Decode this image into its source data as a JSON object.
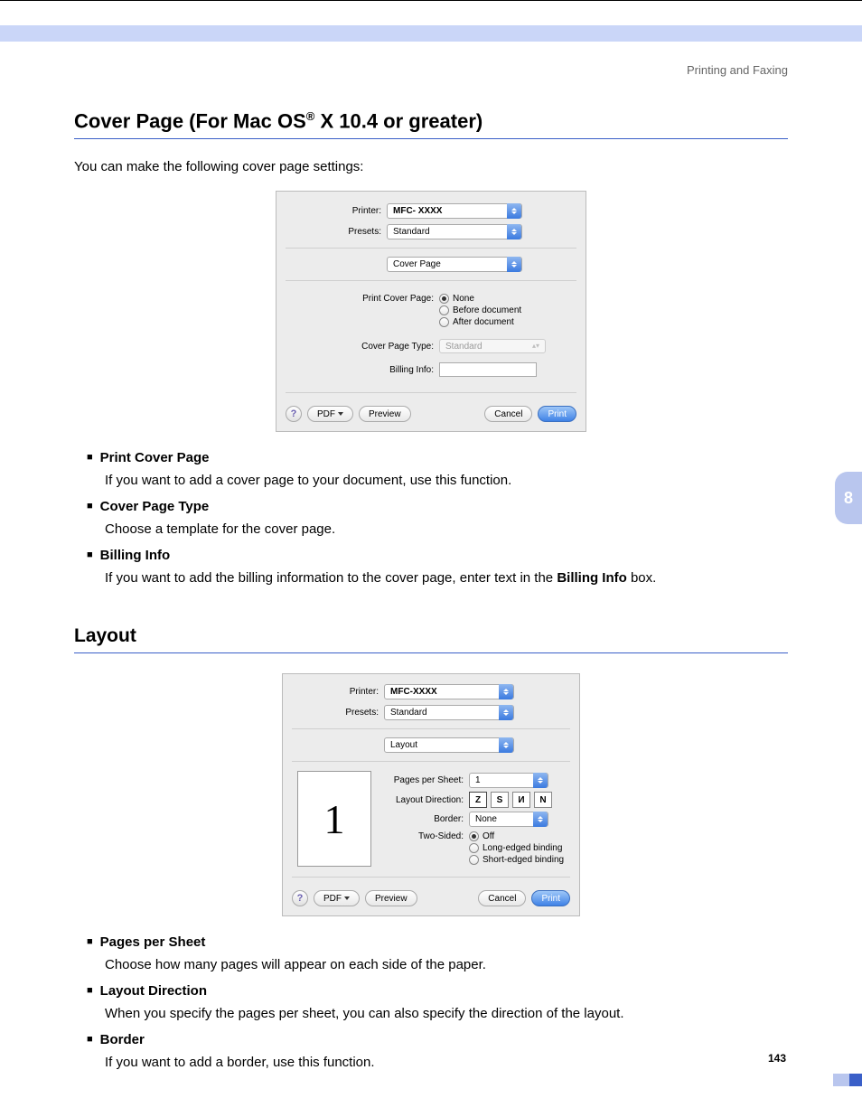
{
  "header": {
    "section": "Printing and Faxing"
  },
  "h1": {
    "pre": "Cover Page (For Mac OS",
    "sup": "®",
    "post": " X 10.4 or greater)"
  },
  "intro1": "You can make the following cover page settings:",
  "dialog1": {
    "labels": {
      "printer": "Printer:",
      "presets": "Presets:",
      "pcp": "Print Cover Page:",
      "cpt": "Cover Page Type:",
      "bill": "Billing Info:"
    },
    "printer_val": "MFC- XXXX",
    "presets_val": "Standard",
    "panel_val": "Cover Page",
    "radios": {
      "none": "None",
      "before": "Before document",
      "after": "After document"
    },
    "cpt_val": "Standard",
    "buttons": {
      "help": "?",
      "pdf": "PDF",
      "preview": "Preview",
      "cancel": "Cancel",
      "print": "Print"
    }
  },
  "bullets1": [
    {
      "head": "Print Cover Page",
      "body": "If you want to add a cover page to your document, use this function."
    },
    {
      "head": "Cover Page Type",
      "body": "Choose a template for the cover page."
    },
    {
      "head": "Billing Info",
      "body_pre": "If you want to add the billing information to the cover page, enter text in the ",
      "body_bold": "Billing Info",
      "body_post": " box."
    }
  ],
  "h2": "Layout",
  "dialog2": {
    "labels": {
      "printer": "Printer:",
      "presets": "Presets:",
      "pps": "Pages per Sheet:",
      "ldir": "Layout Direction:",
      "border": "Border:",
      "two": "Two-Sided:"
    },
    "printer_val": "MFC-XXXX",
    "presets_val": "Standard",
    "panel_val": "Layout",
    "pps_val": "1",
    "border_val": "None",
    "preview_num": "1",
    "radios": {
      "off": "Off",
      "long": "Long-edged binding",
      "short": "Short-edged binding"
    },
    "buttons": {
      "help": "?",
      "pdf": "PDF",
      "preview": "Preview",
      "cancel": "Cancel",
      "print": "Print"
    }
  },
  "bullets2": [
    {
      "head": "Pages per Sheet",
      "body": "Choose how many pages will appear on each side of the paper."
    },
    {
      "head": "Layout Direction",
      "body": "When you specify the pages per sheet, you can also specify the direction of the layout."
    },
    {
      "head": "Border",
      "body": "If you want to add a border, use this function."
    }
  ],
  "chapter": "8",
  "page_num": "143"
}
